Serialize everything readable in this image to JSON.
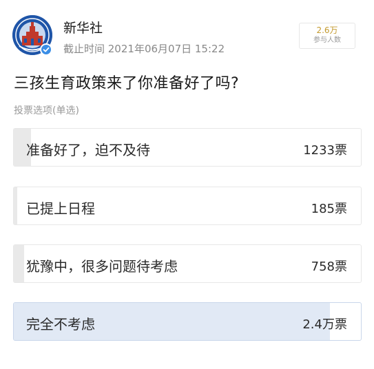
{
  "header": {
    "account_name": "新华社",
    "deadline": "截止时间 2021年06月07日 15:22",
    "avatar_icon": "xinhua-logo-icon",
    "verified_icon": "verified-check-icon",
    "participants_count": "2.6万",
    "participants_label": "参与人数"
  },
  "poll": {
    "question": "三孩生育政策来了你准备好了吗?",
    "vote_type": "投票选项(单选)",
    "options": [
      {
        "label": "准备好了，迫不及待",
        "votes": "1233票",
        "share": 0.05,
        "selected": false
      },
      {
        "label": "已提上日程",
        "votes": "185票",
        "share": 0.01,
        "selected": false
      },
      {
        "label": "犹豫中，很多问题待考虑",
        "votes": "758票",
        "share": 0.03,
        "selected": false
      },
      {
        "label": "完全不考虑",
        "votes": "2.4万票",
        "share": 0.91,
        "selected": true
      }
    ]
  },
  "colors": {
    "brand_blue": "#1f55a8",
    "gold": "#c49a2e",
    "selected_fill": "#e1e9f5",
    "option_fill": "#e9e9e9"
  }
}
